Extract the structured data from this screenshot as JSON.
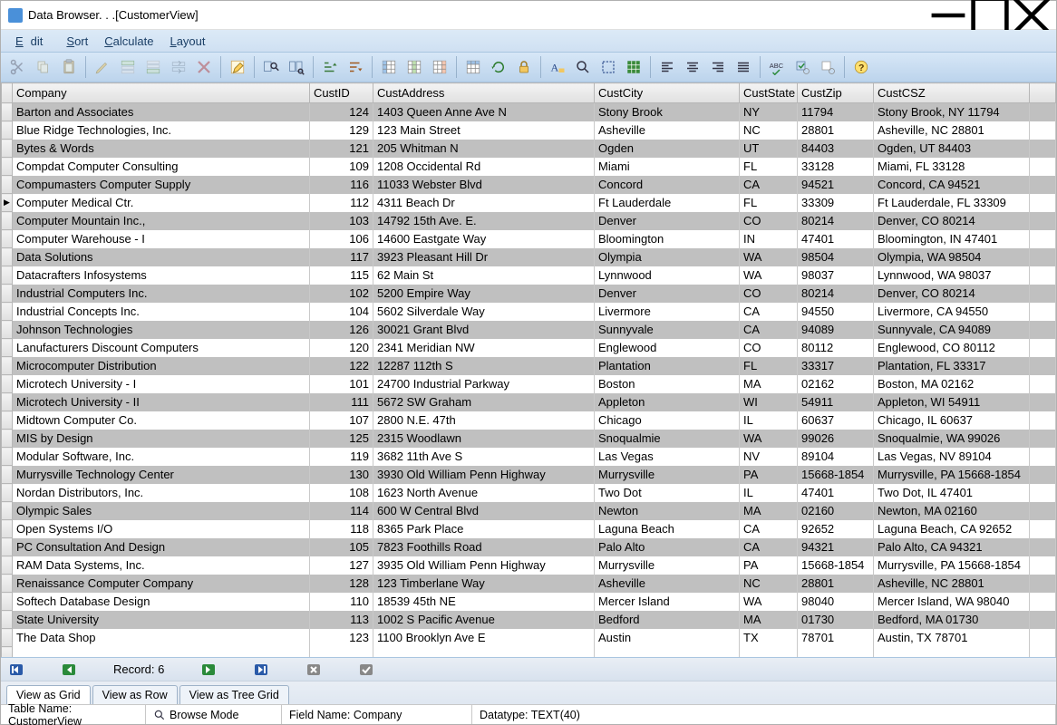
{
  "window": {
    "title": "Data Browser. . .[CustomerView]"
  },
  "menus": {
    "edit": "Edit",
    "sort": "Sort",
    "calculate": "Calculate",
    "layout": "Layout",
    "edit_u": "E",
    "sort_u": "S",
    "calc_u": "C",
    "layout_u": "L"
  },
  "columns": [
    "Company",
    "CustID",
    "CustAddress",
    "CustCity",
    "CustState",
    "CustZip",
    "CustCSZ"
  ],
  "selected_index": 5,
  "rows": [
    {
      "Company": "Barton and Associates",
      "CustID": "124",
      "CustAddress": "1403 Queen Anne Ave N",
      "CustCity": "Stony Brook",
      "CustState": "NY",
      "CustZip": "11794",
      "CustCSZ": "Stony Brook, NY 11794"
    },
    {
      "Company": "Blue Ridge Technologies, Inc.",
      "CustID": "129",
      "CustAddress": "123 Main Street",
      "CustCity": "Asheville",
      "CustState": "NC",
      "CustZip": "28801",
      "CustCSZ": "Asheville, NC 28801"
    },
    {
      "Company": "Bytes & Words",
      "CustID": "121",
      "CustAddress": "205 Whitman N",
      "CustCity": "Ogden",
      "CustState": "UT",
      "CustZip": "84403",
      "CustCSZ": "Ogden, UT 84403"
    },
    {
      "Company": "Compdat Computer Consulting",
      "CustID": "109",
      "CustAddress": "1208 Occidental Rd",
      "CustCity": "Miami",
      "CustState": "FL",
      "CustZip": "33128",
      "CustCSZ": "Miami, FL 33128"
    },
    {
      "Company": "Compumasters Computer Supply",
      "CustID": "116",
      "CustAddress": "11033 Webster Blvd",
      "CustCity": "Concord",
      "CustState": "CA",
      "CustZip": "94521",
      "CustCSZ": "Concord, CA 94521"
    },
    {
      "Company": "Computer Medical Ctr.",
      "CustID": "112",
      "CustAddress": "4311 Beach Dr",
      "CustCity": "Ft Lauderdale",
      "CustState": "FL",
      "CustZip": "33309",
      "CustCSZ": "Ft Lauderdale, FL 33309"
    },
    {
      "Company": "Computer Mountain Inc.,",
      "CustID": "103",
      "CustAddress": "14792 15th Ave. E.",
      "CustCity": "Denver",
      "CustState": "CO",
      "CustZip": "80214",
      "CustCSZ": "Denver, CO 80214"
    },
    {
      "Company": "Computer Warehouse - I",
      "CustID": "106",
      "CustAddress": "14600 Eastgate Way",
      "CustCity": "Bloomington",
      "CustState": "IN",
      "CustZip": "47401",
      "CustCSZ": "Bloomington, IN 47401"
    },
    {
      "Company": "Data Solutions",
      "CustID": "117",
      "CustAddress": "3923 Pleasant Hill Dr",
      "CustCity": "Olympia",
      "CustState": "WA",
      "CustZip": "98504",
      "CustCSZ": "Olympia, WA 98504"
    },
    {
      "Company": "Datacrafters Infosystems",
      "CustID": "115",
      "CustAddress": "62 Main St",
      "CustCity": "Lynnwood",
      "CustState": "WA",
      "CustZip": "98037",
      "CustCSZ": "Lynnwood, WA 98037"
    },
    {
      "Company": "Industrial Computers Inc.",
      "CustID": "102",
      "CustAddress": "5200 Empire Way",
      "CustCity": "Denver",
      "CustState": "CO",
      "CustZip": "80214",
      "CustCSZ": "Denver, CO 80214"
    },
    {
      "Company": "Industrial Concepts Inc.",
      "CustID": "104",
      "CustAddress": "5602 Silverdale Way",
      "CustCity": "Livermore",
      "CustState": "CA",
      "CustZip": "94550",
      "CustCSZ": "Livermore, CA 94550"
    },
    {
      "Company": "Johnson Technologies",
      "CustID": "126",
      "CustAddress": "30021 Grant Blvd",
      "CustCity": "Sunnyvale",
      "CustState": "CA",
      "CustZip": "94089",
      "CustCSZ": "Sunnyvale, CA 94089"
    },
    {
      "Company": "Lanufacturers Discount Computers",
      "CustID": "120",
      "CustAddress": "2341 Meridian NW",
      "CustCity": "Englewood",
      "CustState": "CO",
      "CustZip": "80112",
      "CustCSZ": "Englewood, CO 80112"
    },
    {
      "Company": "Microcomputer Distribution",
      "CustID": "122",
      "CustAddress": "12287 112th S",
      "CustCity": "Plantation",
      "CustState": "FL",
      "CustZip": "33317",
      "CustCSZ": "Plantation, FL 33317"
    },
    {
      "Company": "Microtech University - I",
      "CustID": "101",
      "CustAddress": "24700 Industrial Parkway",
      "CustCity": "Boston",
      "CustState": "MA",
      "CustZip": "02162",
      "CustCSZ": "Boston, MA 02162"
    },
    {
      "Company": "Microtech University - II",
      "CustID": "111",
      "CustAddress": "5672 SW Graham",
      "CustCity": "Appleton",
      "CustState": "WI",
      "CustZip": "54911",
      "CustCSZ": "Appleton, WI 54911"
    },
    {
      "Company": "Midtown Computer Co.",
      "CustID": "107",
      "CustAddress": "2800 N.E. 47th",
      "CustCity": "Chicago",
      "CustState": "IL",
      "CustZip": "60637",
      "CustCSZ": "Chicago, IL 60637"
    },
    {
      "Company": "MIS by Design",
      "CustID": "125",
      "CustAddress": "2315 Woodlawn",
      "CustCity": "Snoqualmie",
      "CustState": "WA",
      "CustZip": "99026",
      "CustCSZ": "Snoqualmie, WA 99026"
    },
    {
      "Company": "Modular Software, Inc.",
      "CustID": "119",
      "CustAddress": "3682 11th Ave S",
      "CustCity": "Las Vegas",
      "CustState": "NV",
      "CustZip": "89104",
      "CustCSZ": "Las Vegas, NV 89104"
    },
    {
      "Company": "Murrysville Technology Center",
      "CustID": "130",
      "CustAddress": "3930 Old William Penn Highway",
      "CustCity": "Murrysville",
      "CustState": "PA",
      "CustZip": "15668-1854",
      "CustCSZ": "Murrysville, PA 15668-1854"
    },
    {
      "Company": "Nordan Distributors, Inc.",
      "CustID": "108",
      "CustAddress": "1623 North Avenue",
      "CustCity": "Two Dot",
      "CustState": "IL",
      "CustZip": "47401",
      "CustCSZ": "Two Dot, IL 47401"
    },
    {
      "Company": "Olympic Sales",
      "CustID": "114",
      "CustAddress": "600 W Central Blvd",
      "CustCity": "Newton",
      "CustState": "MA",
      "CustZip": "02160",
      "CustCSZ": "Newton, MA 02160"
    },
    {
      "Company": "Open Systems I/O",
      "CustID": "118",
      "CustAddress": "8365 Park Place",
      "CustCity": "Laguna Beach",
      "CustState": "CA",
      "CustZip": "92652",
      "CustCSZ": "Laguna Beach, CA 92652"
    },
    {
      "Company": "PC Consultation And Design",
      "CustID": "105",
      "CustAddress": "7823 Foothills Road",
      "CustCity": "Palo Alto",
      "CustState": "CA",
      "CustZip": "94321",
      "CustCSZ": "Palo Alto, CA 94321"
    },
    {
      "Company": "RAM Data Systems, Inc.",
      "CustID": "127",
      "CustAddress": "3935 Old William Penn Highway",
      "CustCity": "Murrysville",
      "CustState": "PA",
      "CustZip": "15668-1854",
      "CustCSZ": "Murrysville, PA 15668-1854"
    },
    {
      "Company": "Renaissance Computer Company",
      "CustID": "128",
      "CustAddress": "123 Timberlane Way",
      "CustCity": "Asheville",
      "CustState": "NC",
      "CustZip": "28801",
      "CustCSZ": "Asheville, NC 28801"
    },
    {
      "Company": "Softech Database Design",
      "CustID": "110",
      "CustAddress": "18539 45th NE",
      "CustCity": "Mercer Island",
      "CustState": "WA",
      "CustZip": "98040",
      "CustCSZ": "Mercer Island, WA 98040"
    },
    {
      "Company": "State University",
      "CustID": "113",
      "CustAddress": "1002 S Pacific Avenue",
      "CustCity": "Bedford",
      "CustState": "MA",
      "CustZip": "01730",
      "CustCSZ": "Bedford, MA 01730"
    },
    {
      "Company": "The Data Shop",
      "CustID": "123",
      "CustAddress": "1100 Brooklyn Ave E",
      "CustCity": "Austin",
      "CustState": "TX",
      "CustZip": "78701",
      "CustCSZ": "Austin, TX 78701"
    }
  ],
  "nav": {
    "record_label": "Record: 6"
  },
  "tabs": {
    "grid": "View as Grid",
    "row": "View as Row",
    "tree": "View as Tree Grid"
  },
  "status": {
    "table": "Table Name: CustomerView",
    "mode": "Browse Mode",
    "field": "Field Name: Company",
    "datatype": "Datatype: TEXT(40)"
  }
}
